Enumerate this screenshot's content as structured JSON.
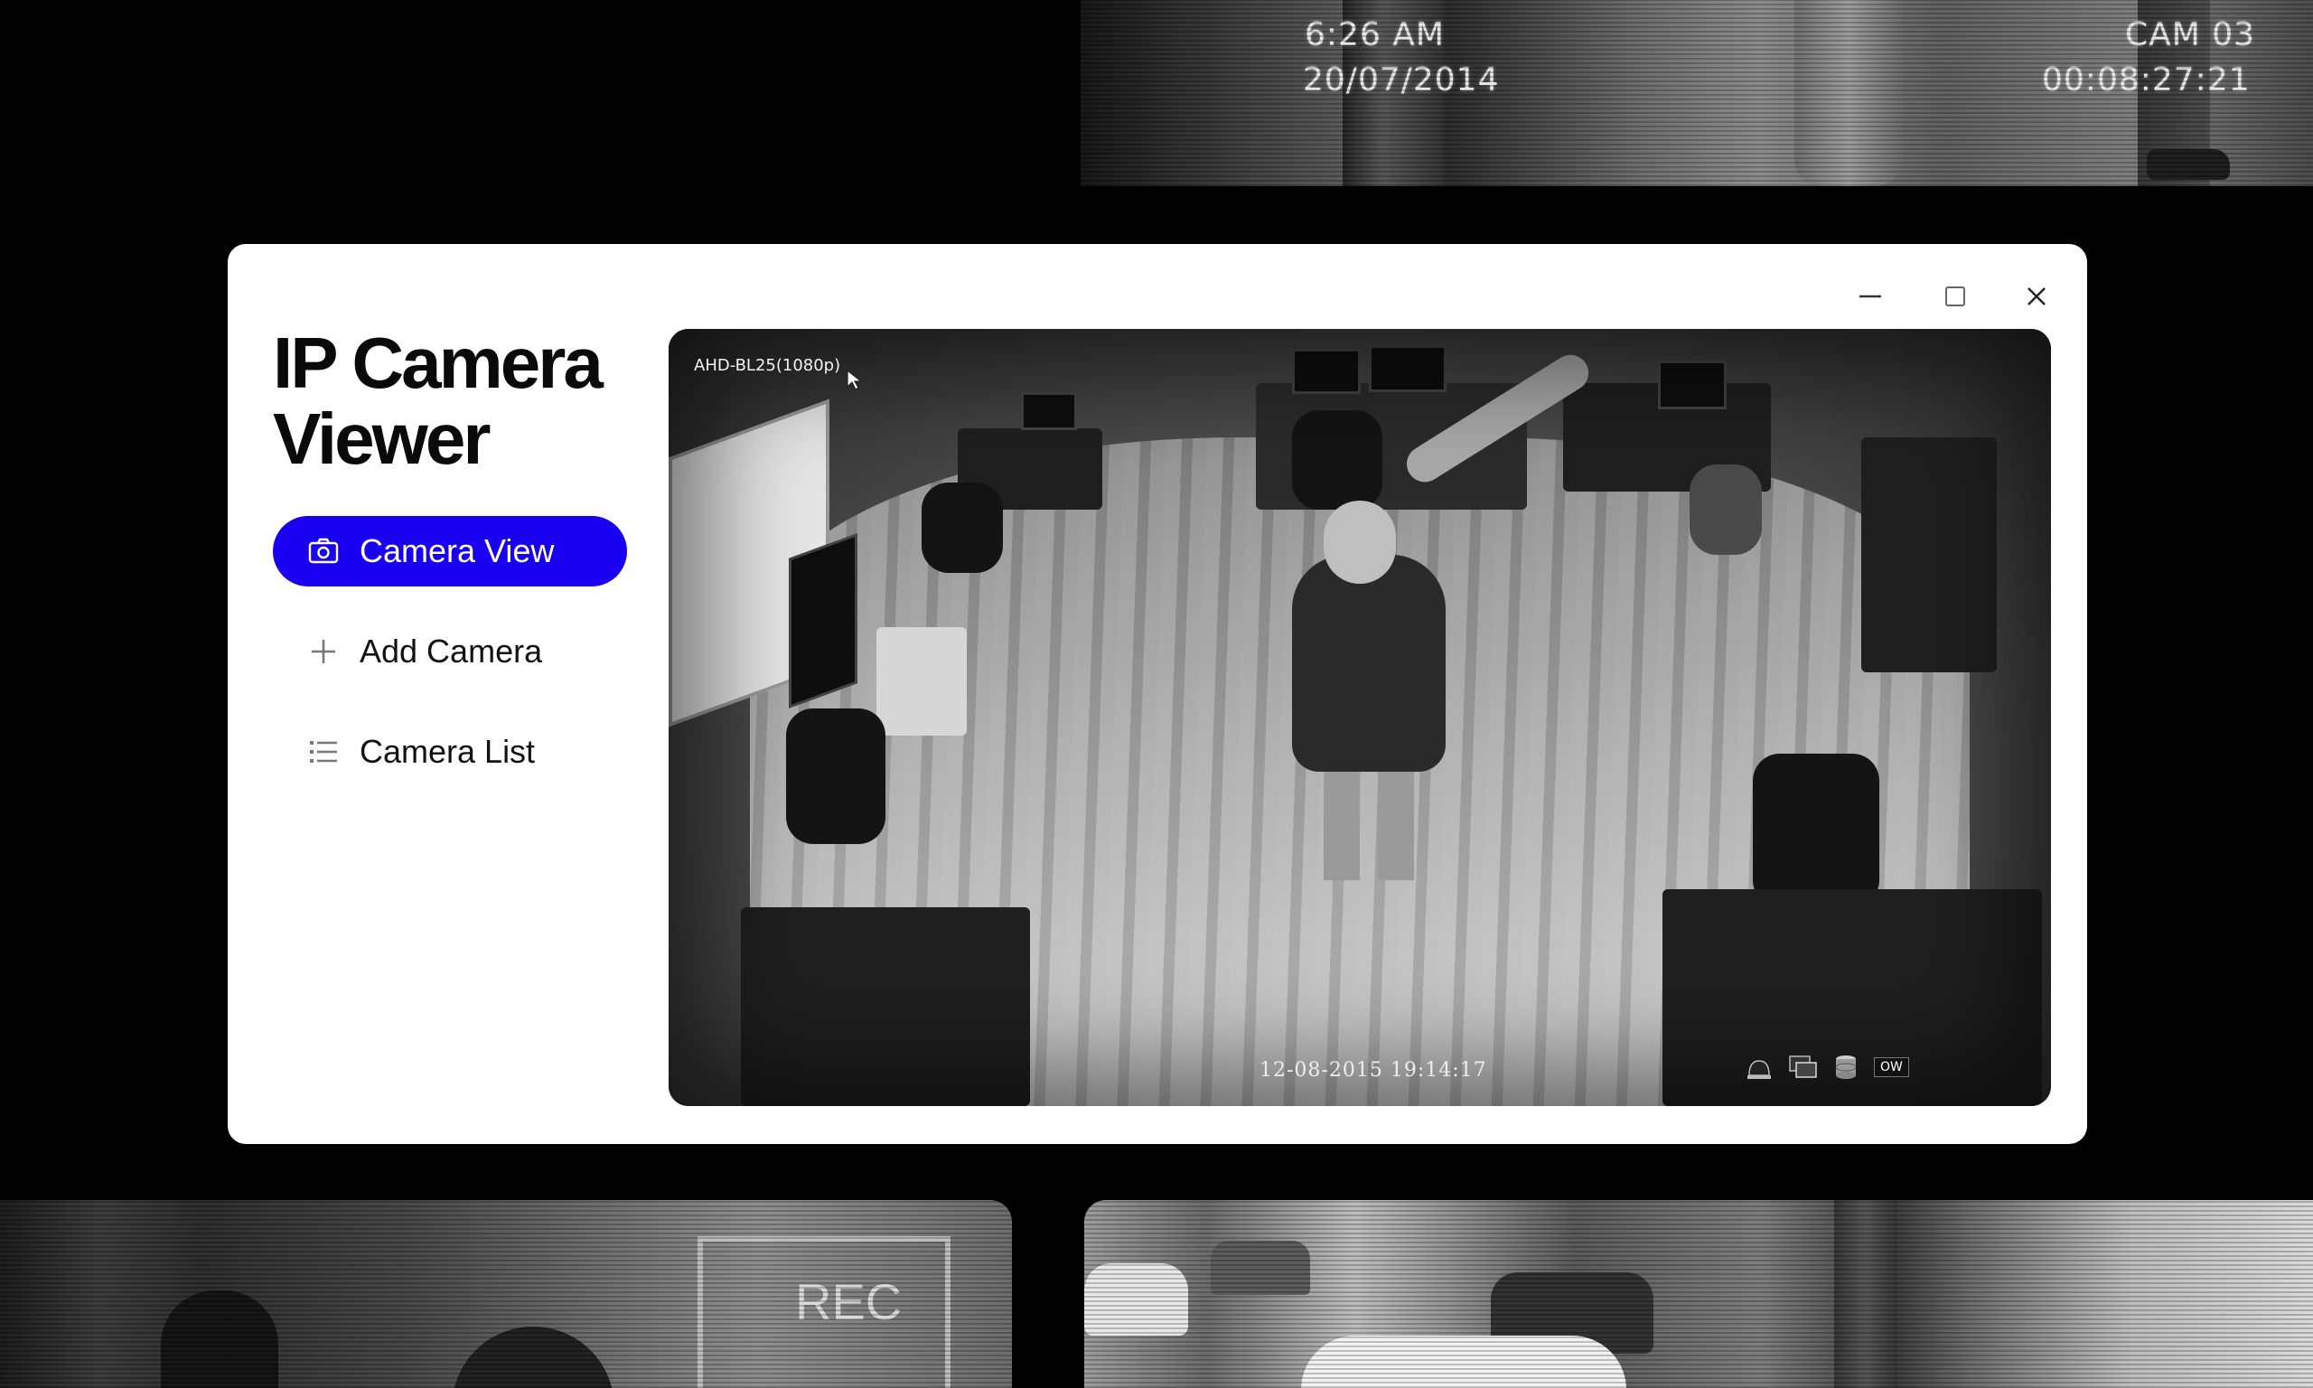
{
  "background_feeds": {
    "top": {
      "time": "6:26 AM",
      "date": "20/07/2014",
      "camera": "CAM 03",
      "elapsed": "00:08:27:21"
    },
    "bottom_left": {
      "label": "REC"
    }
  },
  "window": {
    "title": "IP Camera Viewer",
    "controls": {
      "minimize": "minimize-icon",
      "maximize": "maximize-icon",
      "close": "close-icon"
    }
  },
  "nav": {
    "items": [
      {
        "label": "Camera View",
        "icon": "camera-icon",
        "active": true
      },
      {
        "label": "Add Camera",
        "icon": "plus-icon",
        "active": false
      },
      {
        "label": "Camera List",
        "icon": "list-icon",
        "active": false
      }
    ]
  },
  "viewer": {
    "camera_label": "AHD-BL25(1080p)",
    "timestamp": "12-08-2015  19:14:17",
    "status_badge": "OW"
  },
  "colors": {
    "accent": "#1a00f0",
    "window_bg": "#ffffff",
    "page_bg": "#000000"
  }
}
